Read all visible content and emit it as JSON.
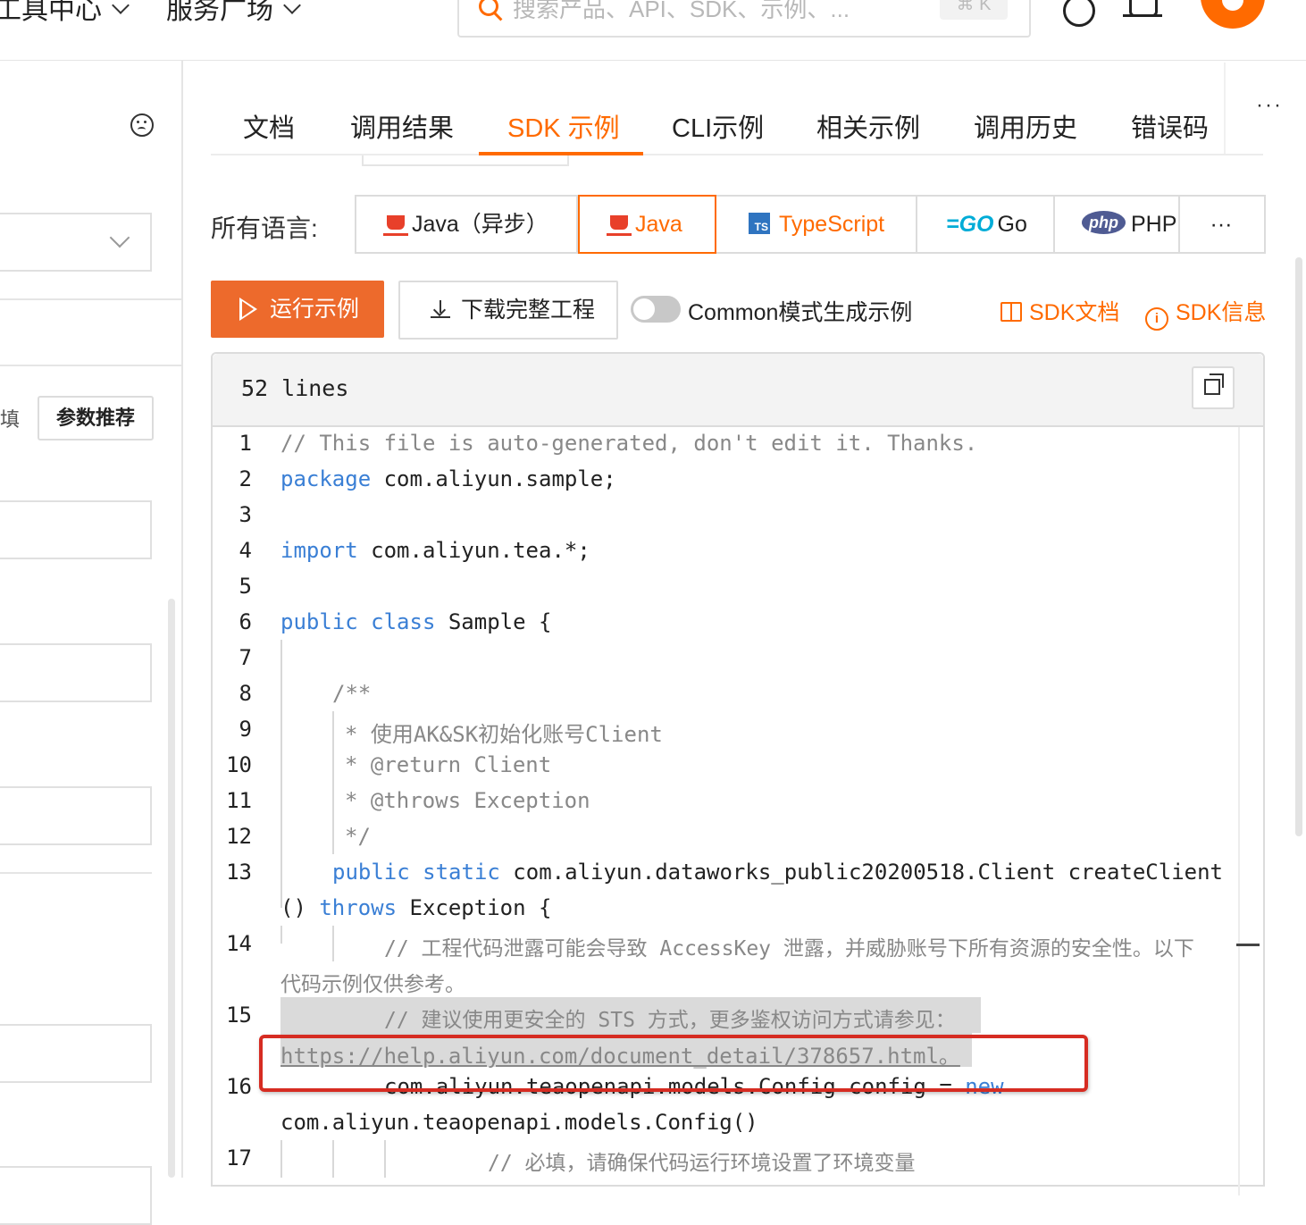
{
  "topnav": {
    "items": [
      "工具中心",
      "服务广场"
    ],
    "search_placeholder": "搜索产品、API、SDK、示例、...",
    "shortcut": "⌘ K"
  },
  "left": {
    "fill_label": "填",
    "recommend_button": "参数推荐"
  },
  "tabs": {
    "items": [
      "文档",
      "调用结果",
      "SDK 示例",
      "CLI示例",
      "相关示例",
      "调用历史",
      "错误码"
    ],
    "active": "SDK 示例",
    "more": "···"
  },
  "languages": {
    "label": "所有语言:",
    "items": [
      "Java（异步）",
      "Java",
      "TypeScript",
      "Go",
      "PHP"
    ],
    "active": "Java",
    "go_logo": "=GO",
    "php_logo": "php",
    "ts_logo": "TS",
    "more": "···"
  },
  "actions": {
    "run": "运行示例",
    "download": "下载完整工程",
    "common_mode": "Common模式生成示例",
    "common_mode_on": false,
    "sdk_docs": "SDK文档",
    "sdk_info": "SDK信息"
  },
  "code": {
    "lines_label": "52 lines",
    "line_numbers": [
      "1",
      "2",
      "3",
      "4",
      "5",
      "6",
      "7",
      "8",
      "9",
      "10",
      "11",
      "12",
      "13",
      "14",
      "15",
      "16",
      "17"
    ],
    "rows": {
      "r1": "// This file is auto-generated, don't edit it. Thanks.",
      "r2_kw": "package",
      "r2": " com.aliyun.sample;",
      "r4_kw": "import",
      "r4": " com.aliyun.tea.*;",
      "r6_kw": "public class",
      "r6": " Sample {",
      "r8": "/**",
      "r9": "* 使用AK&SK初始化账号Client",
      "r10": "* @return Client",
      "r11": "* @throws Exception",
      "r12": "*/",
      "r13_kw": "public static",
      "r13": " com.aliyun.dataworks_public20200518.Client createClient",
      "r13b_a": "() ",
      "r13b_kw": "throws",
      "r13b": " Exception {",
      "r14": "// 工程代码泄露可能会导致 AccessKey 泄露，并威胁账号下所有资源的安全性。以下",
      "r14b": "代码示例仅供参考。",
      "r15": "// 建议使用更安全的 STS 方式，更多鉴权访问方式请参见：",
      "r15b": "https://help.aliyun.com/document_detail/378657.html。",
      "r16": "com.aliyun.teaopenapi.models.Config config = ",
      "r16_kw": "new",
      "r16b": "com.aliyun.teaopenapi.models.Config()",
      "r17": "// 必填，请确保代码运行环境设置了环境变量"
    }
  },
  "colors": {
    "accent": "#ff6a00",
    "keyword": "#3a7fd5",
    "comment": "#888888",
    "annotation": "#d62c22"
  }
}
